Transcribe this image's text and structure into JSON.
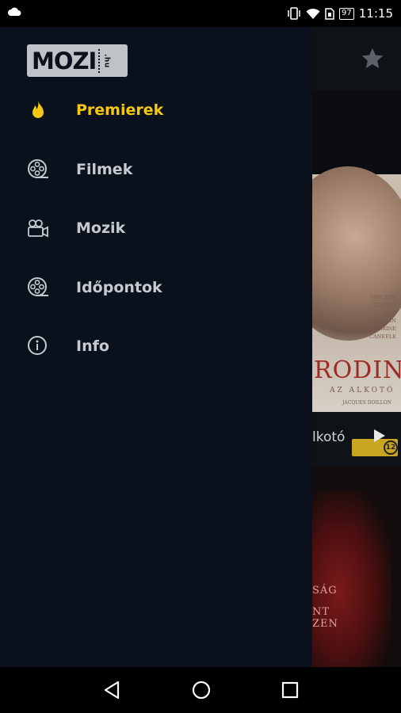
{
  "status_bar": {
    "time": "11:15",
    "battery": "97"
  },
  "drawer": {
    "logo_text": "MOZI",
    "logo_suffix": ".hu",
    "menu": [
      {
        "label": "Premierek",
        "icon": "flame-icon",
        "active": true
      },
      {
        "label": "Filmek",
        "icon": "film-reel-icon",
        "active": false
      },
      {
        "label": "Mozik",
        "icon": "video-camera-icon",
        "active": false
      },
      {
        "label": "Időpontok",
        "icon": "film-reel-icon",
        "active": false
      },
      {
        "label": "Info",
        "icon": "info-icon",
        "active": false
      }
    ]
  },
  "background": {
    "movie_title": "lkotó",
    "poster1_title": "RODIN",
    "poster1_subtitle": "AZ ALKOTÓ",
    "poster1_credits": [
      "VINCENT",
      "LINDON",
      "IZIA",
      "HIGELIN",
      "SÉVERINE",
      "CANEELE"
    ],
    "poster1_small": "JACQUES DOILLON",
    "poster2_line1": "SÁG",
    "poster2_line2": "NT",
    "poster2_line3": "ZEN",
    "age_badge": "12"
  },
  "colors": {
    "accent": "#f6c90e",
    "drawer_bg": "#0a111c",
    "menu_text": "#c6cad0"
  }
}
